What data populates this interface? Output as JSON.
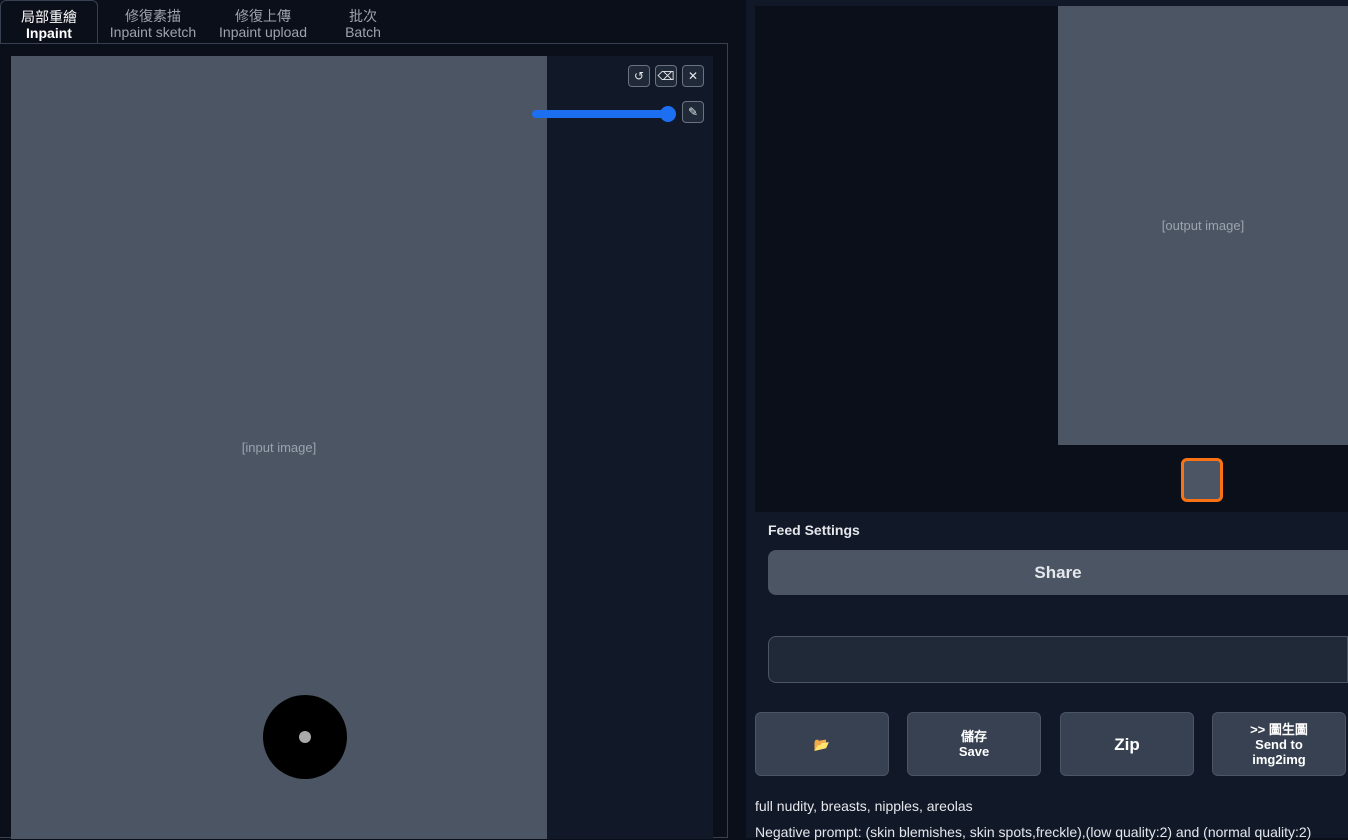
{
  "tabs": [
    {
      "zh": "局部重繪",
      "en": "Inpaint"
    },
    {
      "zh": "修復素描",
      "en": "Inpaint sketch"
    },
    {
      "zh": "修復上傳",
      "en": "Inpaint upload"
    },
    {
      "zh": "批次",
      "en": "Batch"
    }
  ],
  "canvas": {
    "undo_icon": "↺",
    "eraser_icon": "⌫",
    "close_icon": "✕",
    "brush_icon": "✎",
    "brush_size_percent": 100,
    "image_label": "[input image]"
  },
  "output": {
    "image_label": "[output image]"
  },
  "feed_settings": "Feed Settings",
  "share": "Share",
  "buttons": {
    "folder": "📂",
    "save_zh": "儲存",
    "save_en": "Save",
    "zip": "Zip",
    "send_zh": ">> 圖生圖",
    "send_en": "Send to img2img"
  },
  "prompt": "full nudity, breasts, nipples, areolas",
  "negative_prompt": "Negative prompt: (skin blemishes, skin spots,freckle),(low quality:2) and (normal quality:2)"
}
